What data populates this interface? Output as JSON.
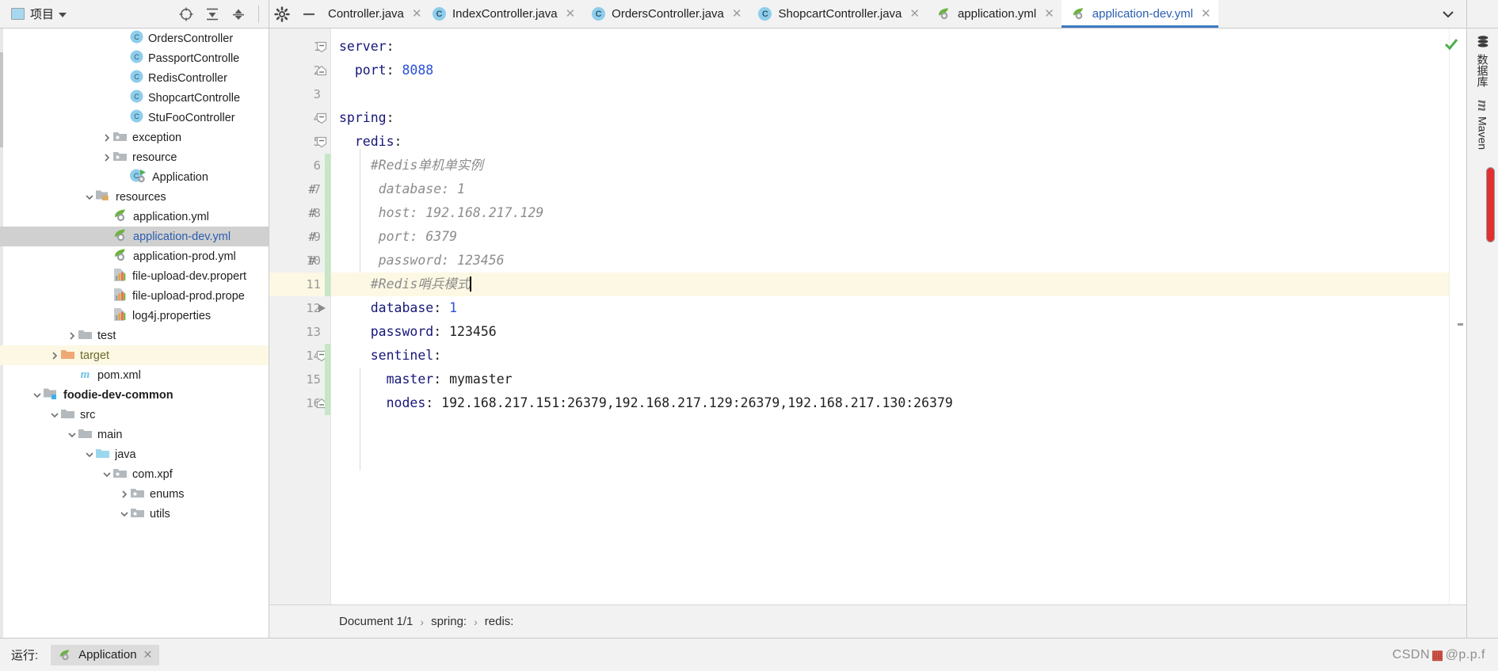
{
  "project_panel": {
    "title": "项目",
    "dropdown_icon": "chevron-down-icon",
    "actions": [
      "locate-icon",
      "expand-all-icon",
      "collapse-all-icon",
      "settings-gear-icon",
      "minimize-icon"
    ]
  },
  "tabs": [
    {
      "label": "Controller.java",
      "icon": "java-class-icon",
      "active": false,
      "truncated": true
    },
    {
      "label": "IndexController.java",
      "icon": "java-class-icon",
      "active": false
    },
    {
      "label": "OrdersController.java",
      "icon": "java-class-icon",
      "active": false
    },
    {
      "label": "ShopcartController.java",
      "icon": "java-class-icon",
      "active": false
    },
    {
      "label": "application.yml",
      "icon": "spring-yml-icon",
      "active": false
    },
    {
      "label": "application-dev.yml",
      "icon": "spring-yml-icon",
      "active": true
    }
  ],
  "tabs_overflow_icon": "chevron-down-icon",
  "tree": [
    {
      "label": "OrdersController",
      "icon": "java-class-icon",
      "indent": 7,
      "arrow": "",
      "state": ""
    },
    {
      "label": "PassportControlle",
      "icon": "java-class-icon",
      "indent": 7,
      "arrow": "",
      "state": ""
    },
    {
      "label": "RedisController",
      "icon": "java-class-icon",
      "indent": 7,
      "arrow": "",
      "state": ""
    },
    {
      "label": "ShopcartControlle",
      "icon": "java-class-icon",
      "indent": 7,
      "arrow": "",
      "state": ""
    },
    {
      "label": "StuFooController",
      "icon": "java-class-icon",
      "indent": 7,
      "arrow": "",
      "state": ""
    },
    {
      "label": "exception",
      "icon": "package-folder-icon",
      "indent": 6,
      "arrow": "collapsed",
      "state": ""
    },
    {
      "label": "resource",
      "icon": "package-folder-icon",
      "indent": 6,
      "arrow": "collapsed",
      "state": ""
    },
    {
      "label": "Application",
      "icon": "java-runnable-class-icon",
      "indent": 7,
      "arrow": "",
      "state": ""
    },
    {
      "label": "resources",
      "icon": "resources-folder-icon",
      "indent": 5,
      "arrow": "expanded",
      "state": ""
    },
    {
      "label": "application.yml",
      "icon": "spring-yml-icon",
      "indent": 6,
      "arrow": "",
      "state": ""
    },
    {
      "label": "application-dev.yml",
      "icon": "spring-yml-icon",
      "indent": 6,
      "arrow": "",
      "state": "selected"
    },
    {
      "label": "application-prod.yml",
      "icon": "spring-yml-icon",
      "indent": 6,
      "arrow": "",
      "state": ""
    },
    {
      "label": "file-upload-dev.propert",
      "icon": "properties-file-icon",
      "indent": 6,
      "arrow": "",
      "state": ""
    },
    {
      "label": "file-upload-prod.prope",
      "icon": "properties-file-icon",
      "indent": 6,
      "arrow": "",
      "state": ""
    },
    {
      "label": "log4j.properties",
      "icon": "properties-file-icon",
      "indent": 6,
      "arrow": "",
      "state": ""
    },
    {
      "label": "test",
      "icon": "folder-icon",
      "indent": 4,
      "arrow": "collapsed",
      "state": ""
    },
    {
      "label": "target",
      "icon": "excluded-folder-icon",
      "indent": 3,
      "arrow": "collapsed",
      "state": "highlighted"
    },
    {
      "label": "pom.xml",
      "icon": "maven-pom-icon",
      "indent": 4,
      "arrow": "",
      "state": ""
    },
    {
      "label": "foodie-dev-common",
      "icon": "module-folder-icon",
      "indent": 2,
      "arrow": "expanded",
      "state": "bold"
    },
    {
      "label": "src",
      "icon": "folder-icon",
      "indent": 3,
      "arrow": "expanded",
      "state": ""
    },
    {
      "label": "main",
      "icon": "folder-icon",
      "indent": 4,
      "arrow": "expanded",
      "state": ""
    },
    {
      "label": "java",
      "icon": "source-folder-icon",
      "indent": 5,
      "arrow": "expanded",
      "state": ""
    },
    {
      "label": "com.xpf",
      "icon": "package-folder-icon",
      "indent": 6,
      "arrow": "expanded",
      "state": ""
    },
    {
      "label": "enums",
      "icon": "package-folder-icon",
      "indent": 7,
      "arrow": "collapsed",
      "state": ""
    },
    {
      "label": "utils",
      "icon": "package-folder-icon",
      "indent": 7,
      "arrow": "expanded",
      "state": ""
    }
  ],
  "editor": {
    "lines": [
      {
        "n": "1",
        "fold": "minus-square",
        "hash": "",
        "green": false,
        "current": false,
        "tokens": [
          {
            "t": "server",
            "c": "kw"
          },
          {
            "t": ":",
            "c": "plain"
          }
        ]
      },
      {
        "n": "2",
        "fold": "minus-end",
        "hash": "",
        "green": false,
        "current": false,
        "tokens": [
          {
            "t": "  ",
            "c": "plain"
          },
          {
            "t": "port",
            "c": "kw"
          },
          {
            "t": ": ",
            "c": "plain"
          },
          {
            "t": "8088",
            "c": "num"
          }
        ]
      },
      {
        "n": "3",
        "fold": "",
        "hash": "",
        "green": false,
        "current": false,
        "tokens": []
      },
      {
        "n": "4",
        "fold": "minus-square",
        "hash": "",
        "green": false,
        "current": false,
        "tokens": [
          {
            "t": "spring",
            "c": "kw"
          },
          {
            "t": ":",
            "c": "plain"
          }
        ]
      },
      {
        "n": "5",
        "fold": "minus-square",
        "hash": "",
        "green": false,
        "current": false,
        "tokens": [
          {
            "t": "  ",
            "c": "plain"
          },
          {
            "t": "redis",
            "c": "kw"
          },
          {
            "t": ":",
            "c": "plain"
          }
        ]
      },
      {
        "n": "6",
        "fold": "",
        "hash": "",
        "green": true,
        "current": false,
        "tokens": [
          {
            "t": "    #Redis单机单实例",
            "c": "cmt"
          }
        ]
      },
      {
        "n": "7",
        "fold": "",
        "hash": "#",
        "green": true,
        "current": false,
        "tokens": [
          {
            "t": "     database: 1",
            "c": "cmt"
          }
        ]
      },
      {
        "n": "8",
        "fold": "",
        "hash": "#",
        "green": true,
        "current": false,
        "tokens": [
          {
            "t": "     host: 192.168.217.129",
            "c": "cmt"
          }
        ]
      },
      {
        "n": "9",
        "fold": "",
        "hash": "#",
        "green": true,
        "current": false,
        "tokens": [
          {
            "t": "     port: 6379",
            "c": "cmt"
          }
        ]
      },
      {
        "n": "10",
        "fold": "",
        "hash": "#",
        "green": true,
        "current": false,
        "tokens": [
          {
            "t": "     password: 123456",
            "c": "cmt"
          }
        ]
      },
      {
        "n": "11",
        "fold": "",
        "hash": "",
        "green": true,
        "current": true,
        "tokens": [
          {
            "t": "    #Redis哨兵模式",
            "c": "cmt"
          }
        ],
        "caret": true
      },
      {
        "n": "12",
        "fold": "run-arrow",
        "hash": "",
        "green": false,
        "current": false,
        "tokens": [
          {
            "t": "    ",
            "c": "plain"
          },
          {
            "t": "database",
            "c": "kw"
          },
          {
            "t": ": ",
            "c": "plain"
          },
          {
            "t": "1",
            "c": "num"
          }
        ]
      },
      {
        "n": "13",
        "fold": "",
        "hash": "",
        "green": false,
        "current": false,
        "tokens": [
          {
            "t": "    ",
            "c": "plain"
          },
          {
            "t": "password",
            "c": "kw"
          },
          {
            "t": ": ",
            "c": "plain"
          },
          {
            "t": "123456",
            "c": "plain"
          }
        ]
      },
      {
        "n": "14",
        "fold": "minus-square",
        "hash": "",
        "green": true,
        "current": false,
        "tokens": [
          {
            "t": "    ",
            "c": "plain"
          },
          {
            "t": "sentinel",
            "c": "kw"
          },
          {
            "t": ":",
            "c": "plain"
          }
        ]
      },
      {
        "n": "15",
        "fold": "",
        "hash": "",
        "green": true,
        "current": false,
        "tokens": [
          {
            "t": "      ",
            "c": "plain"
          },
          {
            "t": "master",
            "c": "kw"
          },
          {
            "t": ": ",
            "c": "plain"
          },
          {
            "t": "mymaster",
            "c": "plain"
          }
        ]
      },
      {
        "n": "16",
        "fold": "minus-end",
        "hash": "",
        "green": true,
        "current": false,
        "tokens": [
          {
            "t": "      ",
            "c": "plain"
          },
          {
            "t": "nodes",
            "c": "kw"
          },
          {
            "t": ": ",
            "c": "plain"
          },
          {
            "t": "192.168.217.151:26379,192.168.217.129:26379,192.168.217.130:26379",
            "c": "plain"
          }
        ]
      }
    ],
    "inspection_status": "ok-check-icon"
  },
  "breadcrumb": {
    "document": "Document 1/1",
    "items": [
      "spring:",
      "redis:"
    ],
    "separator": "›"
  },
  "right_strip": [
    {
      "label": "数据库",
      "icon": "database-icon"
    },
    {
      "label": "Maven",
      "icon": "maven-m-icon"
    }
  ],
  "bottom": {
    "run_label": "运行:",
    "run_tab": "Application",
    "run_tab_icon": "spring-boot-icon",
    "run_tab_close": "close-icon",
    "watermark_prefix": "CSDN",
    "watermark_rest": "@p.p.f"
  },
  "colors": {
    "accent": "#3c7ac2",
    "link": "#2a5db0",
    "keyword": "#17177a",
    "number": "#2a4fd7",
    "comment": "#8c8c8c",
    "current_line": "#fcf8e3",
    "selection": "#d0d0d0",
    "green_change": "#c6e6c6",
    "panel_bg": "#f2f2f2"
  }
}
